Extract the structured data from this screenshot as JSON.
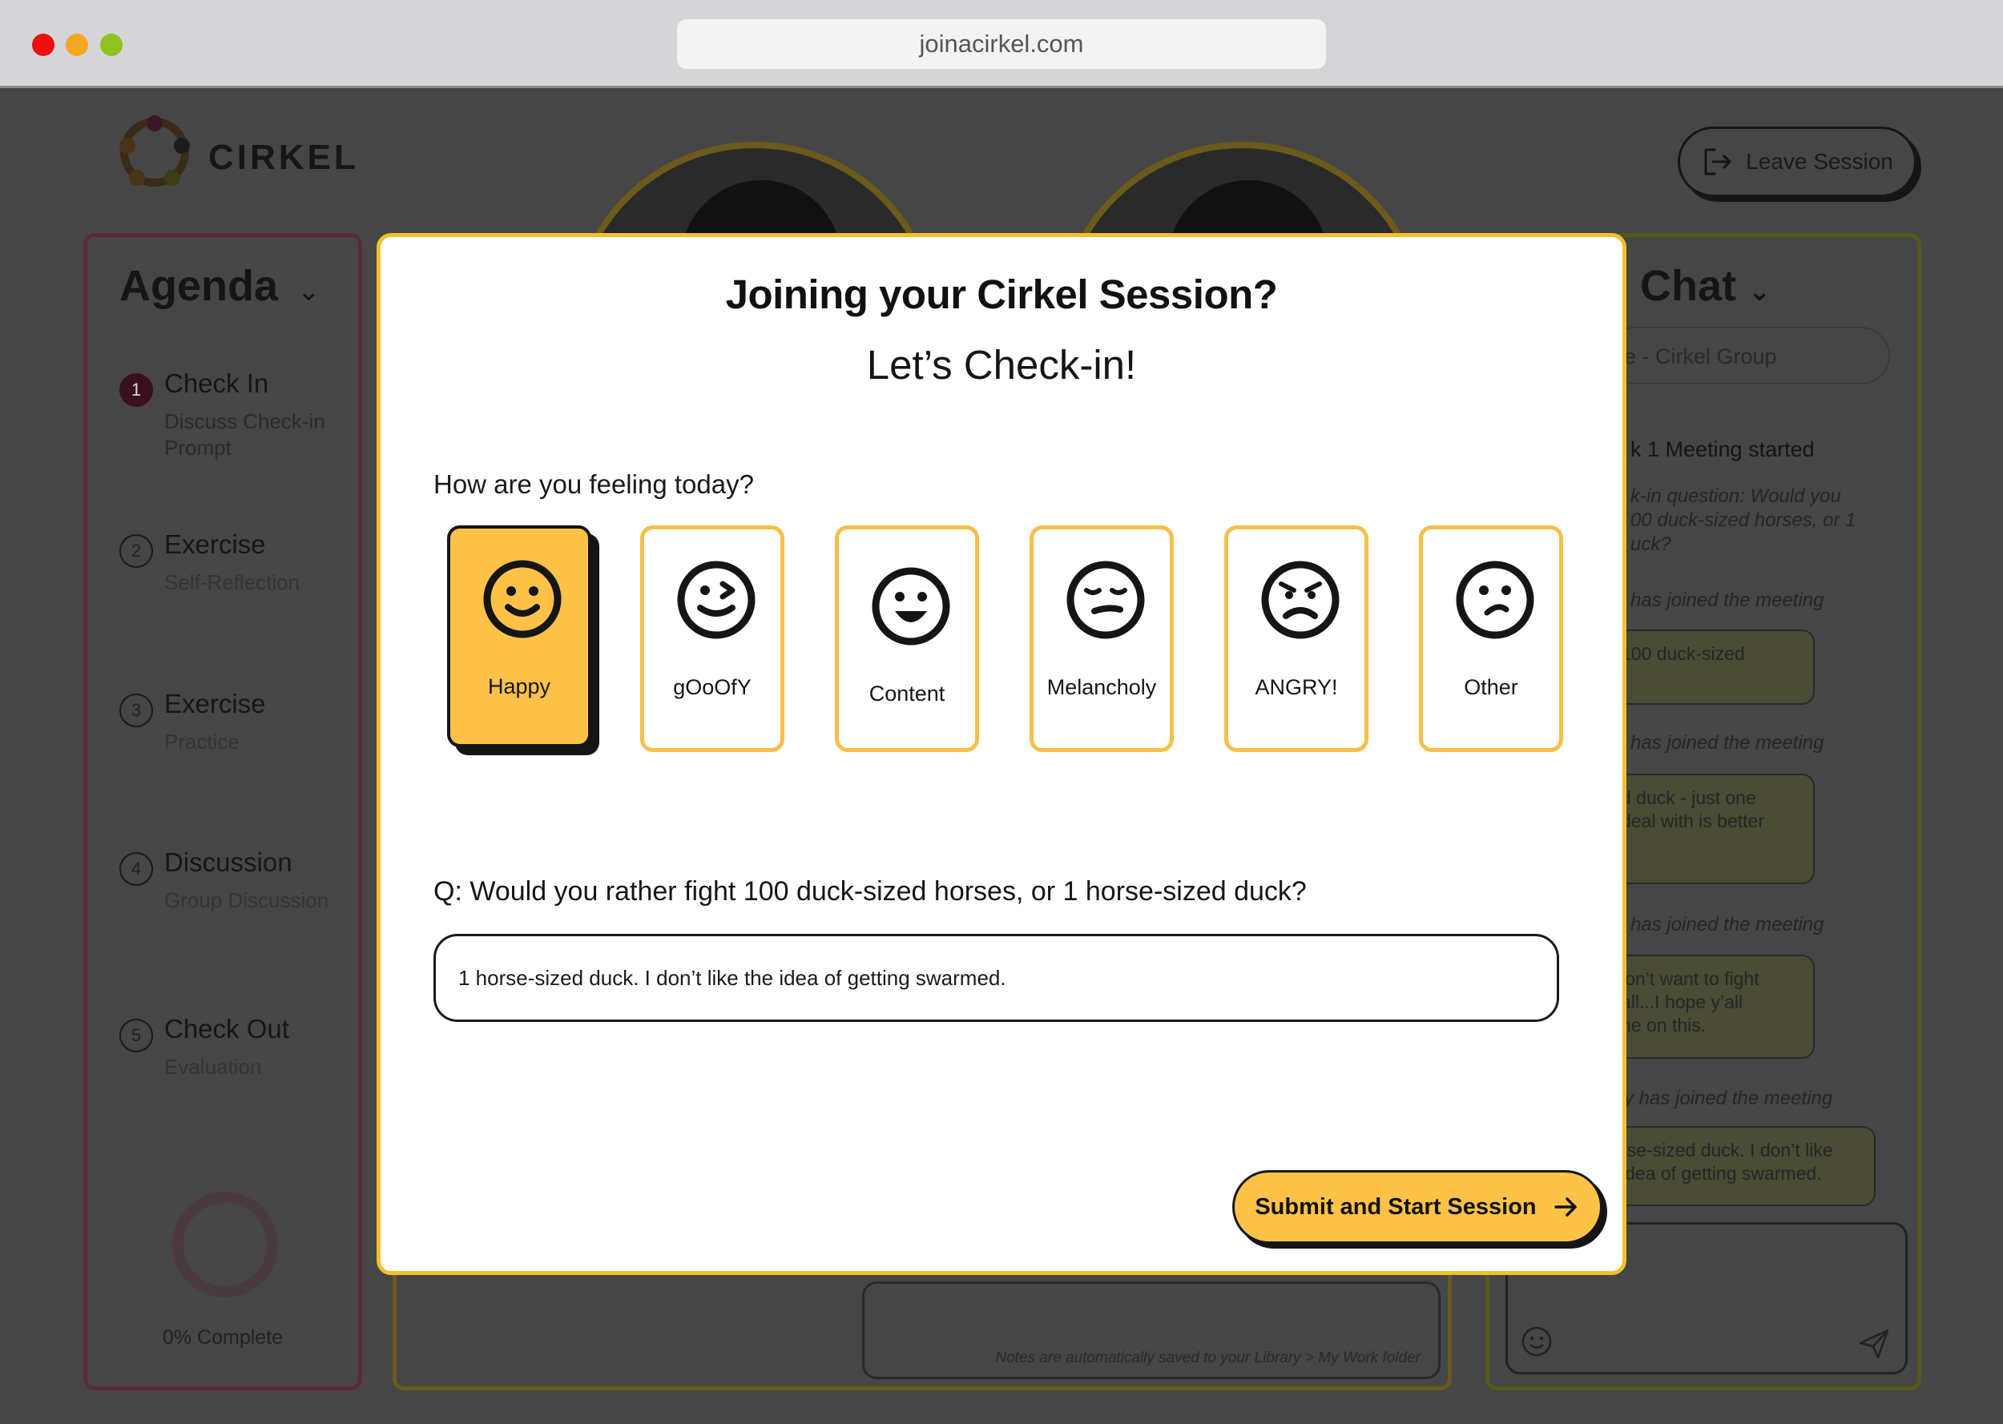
{
  "browser": {
    "url": "joinacirkel.com"
  },
  "header": {
    "logo_text": "CIRKEL",
    "leave_label": "Leave Session"
  },
  "agenda": {
    "title": "Agenda",
    "items": [
      {
        "num": "1",
        "label": "Check In",
        "sub": "Discuss Check-in Prompt"
      },
      {
        "num": "2",
        "label": "Exercise",
        "sub": "Self-Reflection"
      },
      {
        "num": "3",
        "label": "Exercise",
        "sub": "Practice"
      },
      {
        "num": "4",
        "label": "Discussion",
        "sub": "Group Discussion"
      },
      {
        "num": "5",
        "label": "Check Out",
        "sub": "Evaluation"
      }
    ],
    "progress_label": "0% Complete",
    "progress_value": 0
  },
  "notes": {
    "hint": "Notes are automatically saved to your Library > My Work folder"
  },
  "chat": {
    "title": "o Chat",
    "select_value": "e - Cirkel Group",
    "lines": [
      {
        "text": "k 1 Meeting started"
      },
      {
        "text": "k-in question: Would you"
      },
      {
        "text": "00 duck-sized horses, or 1"
      },
      {
        "text": "uck?"
      },
      {
        "text": "has joined the meeting"
      },
      {
        "text": "100 duck-sized"
      },
      {
        "text": "has joined the meeting"
      },
      {
        "text": "d duck - just one"
      },
      {
        "text": "deal with is better"
      },
      {
        "text": "has joined the meeting"
      },
      {
        "text": "lon’t want to fight"
      },
      {
        "text": "all...I hope y’all"
      },
      {
        "text": "ne on this."
      },
      {
        "text": "y has joined the meeting"
      },
      {
        "text": "rse-sized duck. I don’t like"
      },
      {
        "text": "idea of getting swarmed."
      }
    ]
  },
  "modal": {
    "title": "Joining your Cirkel Session?",
    "subtitle": "Let’s Check-in!",
    "feeling_question": "How are you feeling today?",
    "moods": [
      {
        "label": "Happy",
        "icon": "happy-face-icon",
        "selected": true
      },
      {
        "label": "gOoOfY",
        "icon": "goofy-face-icon",
        "selected": false
      },
      {
        "label": "Content",
        "icon": "content-face-icon",
        "selected": false
      },
      {
        "label": "Melancholy",
        "icon": "melancholy-face-icon",
        "selected": false
      },
      {
        "label": "ANGRY!",
        "icon": "angry-face-icon",
        "selected": false
      },
      {
        "label": "Other",
        "icon": "other-face-icon",
        "selected": false
      }
    ],
    "checkin_question": "Q: Would you rather fight 100 duck-sized horses, or 1 horse-sized duck?",
    "answer_value": "1 horse-sized duck. I don’t like the idea of getting swarmed.",
    "submit_label": "Submit and Start Session"
  },
  "colors": {
    "accent": "#fec248",
    "modal_border": "#f5c02c",
    "overlay": "#464646"
  }
}
